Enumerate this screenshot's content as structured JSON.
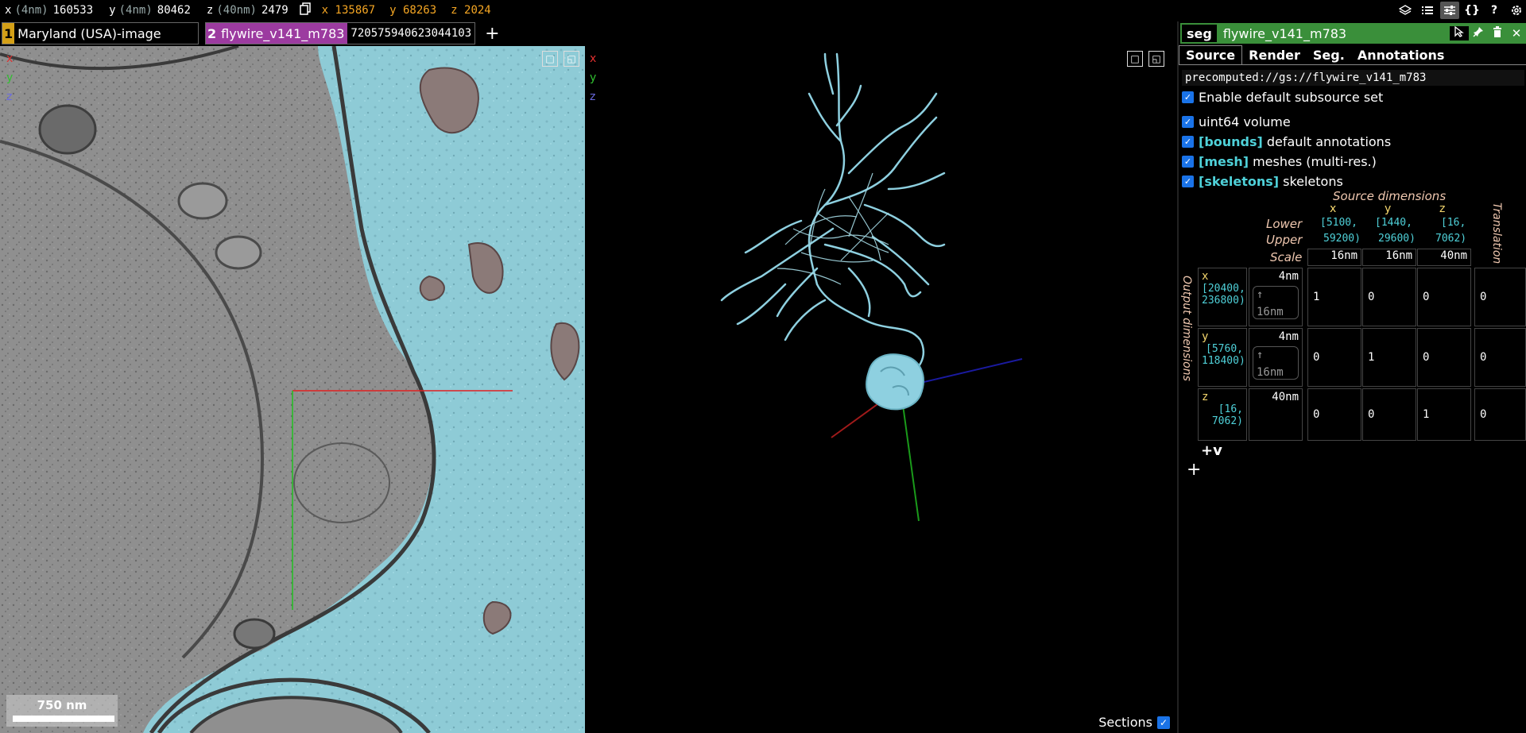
{
  "topbar": {
    "coords": [
      {
        "axis": "x",
        "unit": "(4nm)",
        "value": "160533"
      },
      {
        "axis": "y",
        "unit": "(4nm)",
        "value": "80462"
      },
      {
        "axis": "z",
        "unit": "(40nm)",
        "value": "2479"
      }
    ],
    "mouse": [
      {
        "axis": "x",
        "value": "135867"
      },
      {
        "axis": "y",
        "value": "68263"
      },
      {
        "axis": "z",
        "value": "2024"
      }
    ],
    "icons": [
      "layers-icon",
      "list-icon",
      "sliders-icon",
      "braces-icon",
      "help-icon",
      "settings-icon"
    ]
  },
  "layers": [
    {
      "num": "1",
      "name": "Maryland (USA)-image"
    },
    {
      "num": "2",
      "name": "flywire_v141_m783",
      "segment": "720575940623044103"
    }
  ],
  "panel2d": {
    "axes": [
      "x",
      "y",
      "z"
    ],
    "scale_label": "750 nm"
  },
  "panel3d": {
    "axes": [
      "x",
      "y",
      "z"
    ],
    "sections_label": "Sections"
  },
  "side": {
    "kind": "seg",
    "title": "flywire_v141_m783",
    "tabs": [
      "Source",
      "Render",
      "Seg.",
      "Annotations"
    ],
    "source_url": "precomputed://gs://flywire_v141_m783",
    "enable_default": "Enable default subsource set",
    "subsources": [
      {
        "tag": "",
        "label": "uint64 volume"
      },
      {
        "tag": "[bounds]",
        "label": "default annotations"
      },
      {
        "tag": "[mesh]",
        "label": "meshes (multi-res.)"
      },
      {
        "tag": "[skeletons]",
        "label": "skeletons"
      }
    ],
    "dims": {
      "source_title": "Source dimensions",
      "translation": "Translation",
      "output": "Output dimensions",
      "lower": "Lower",
      "upper": "Upper",
      "scale": "Scale",
      "cols": [
        {
          "name": "x",
          "lower": "[5100,",
          "upper": "59200)",
          "scale": "16nm"
        },
        {
          "name": "y",
          "lower": "[1440,",
          "upper": "29600)",
          "scale": "16nm"
        },
        {
          "name": "z",
          "lower": "[16,",
          "upper": "7062)",
          "scale": "40nm"
        }
      ],
      "rows": [
        {
          "name": "x",
          "range1": "[20400,",
          "range2": "236800)",
          "scale": "4nm",
          "sub": "16nm",
          "m": [
            "1",
            "0",
            "0"
          ],
          "t": "0"
        },
        {
          "name": "y",
          "range1": "[5760,",
          "range2": "118400)",
          "scale": "4nm",
          "sub": "16nm",
          "m": [
            "0",
            "1",
            "0"
          ],
          "t": "0"
        },
        {
          "name": "z",
          "range1": "[16,",
          "range2": "7062)",
          "scale": "40nm",
          "sub": "",
          "m": [
            "0",
            "0",
            "1"
          ],
          "t": "0"
        }
      ],
      "add_dim": "+v",
      "add": "+"
    }
  }
}
